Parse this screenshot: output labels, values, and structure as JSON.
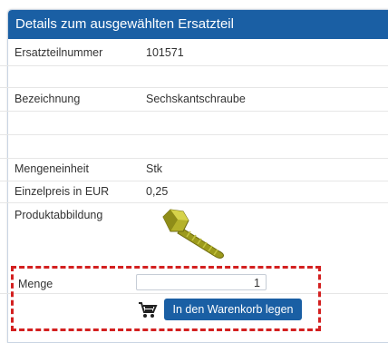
{
  "panel": {
    "title": "Details zum ausgewählten Ersatzteil"
  },
  "details": [
    {
      "label": "Ersatzteilnummer",
      "value": "101571"
    },
    {
      "label": "Bezeichnung",
      "value": "Sechskantschraube"
    },
    {
      "label": "Mengeneinheit",
      "value": "Stk"
    },
    {
      "label": "Einzelpreis in EUR",
      "value": "0,25"
    },
    {
      "label": "Produktabbildung",
      "value": ""
    }
  ],
  "order": {
    "quantity_label": "Menge",
    "quantity_value": "1",
    "add_to_cart_label": "In den Warenkorb legen",
    "cart_icon": "shopping-cart-icon"
  },
  "colors": {
    "header": "#1a5fa4",
    "button": "#1a5fa4",
    "highlight_border": "#d32020"
  }
}
